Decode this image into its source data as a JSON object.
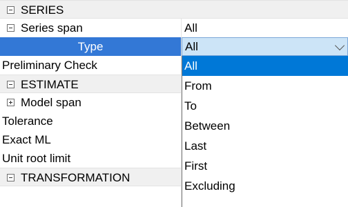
{
  "categories": {
    "series": "SERIES",
    "estimate": "ESTIMATE",
    "transformation": "TRANSFORMATION"
  },
  "properties": {
    "series_span": {
      "name": "Series span",
      "value": "All"
    },
    "type": {
      "name": "Type",
      "value": "All"
    },
    "preliminary_check": {
      "name": "Preliminary Check"
    },
    "model_span": {
      "name": "Model span"
    },
    "tolerance": {
      "name": "Tolerance"
    },
    "exact_ml": {
      "name": "Exact ML"
    },
    "unit_root_limit": {
      "name": "Unit root limit"
    }
  },
  "dropdown": {
    "options": [
      "All",
      "From",
      "To",
      "Between",
      "Last",
      "First",
      "Excluding"
    ],
    "selected": "All"
  },
  "colors": {
    "selection": "#0078d7",
    "row_selection": "#3378d6",
    "combo_background": "#cce4f7",
    "category_background": "#f0f0f0"
  },
  "icons": {
    "collapse": "minus-box-icon",
    "expand": "plus-box-icon",
    "dropdown_arrow": "chevron-down-icon"
  }
}
